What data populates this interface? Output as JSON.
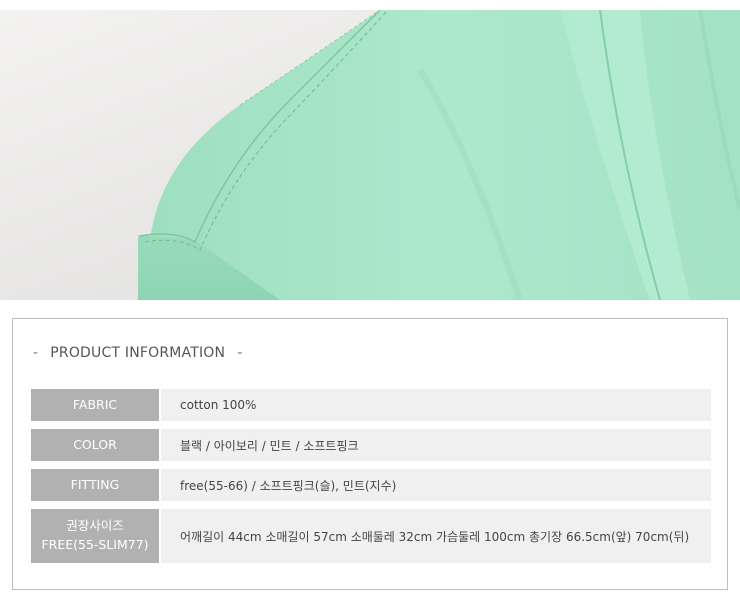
{
  "photo": {
    "subject": "mint shirt shoulder",
    "colors": {
      "background": "#ecebea",
      "shirt": "#a8e6c8",
      "shirt_shadow": "#8fd8b6",
      "stitch": "#6fb893"
    }
  },
  "product_info": {
    "title": "PRODUCT INFORMATION",
    "dash": "-",
    "rows": [
      {
        "label": "FABRIC",
        "value": "cotton 100%"
      },
      {
        "label": "COLOR",
        "value": "블랙 / 아이보리 / 민트 / 소프트핑크"
      },
      {
        "label": "FITTING",
        "value": "free(55-66) / 소프트핑크(슬), 민트(지수)"
      },
      {
        "label_line1": "권장사이즈",
        "label_line2": "FREE(55-SLIM77)",
        "value": "어깨길이 44cm 소매길이 57cm 소매둘레 32cm 가슴둘레 100cm 총기장 66.5cm(앞) 70cm(뒤)"
      }
    ],
    "colors": {
      "label_bg": "#b1b1b1",
      "value_bg": "#f0f0f0",
      "border": "#bdbdbd"
    }
  }
}
